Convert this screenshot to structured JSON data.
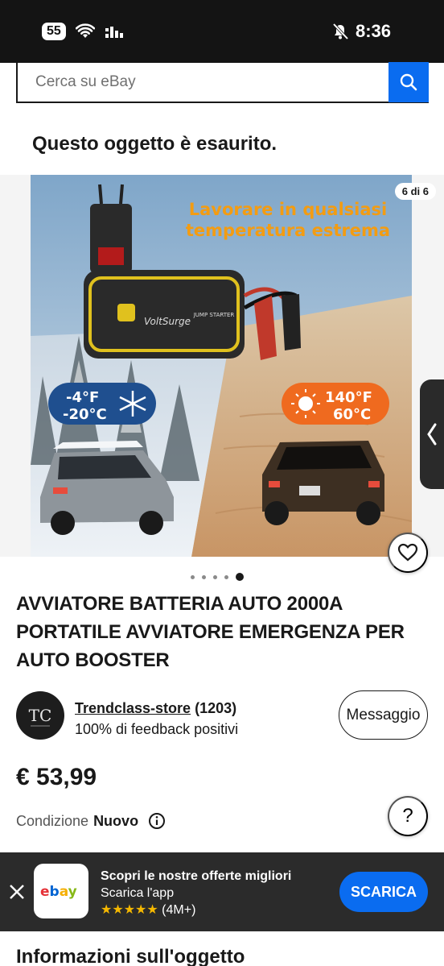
{
  "status_bar": {
    "signal_badge": "55",
    "time": "8:36"
  },
  "search": {
    "placeholder": "Cerca su eBay"
  },
  "out_of_stock": "Questo oggetto è esaurito.",
  "gallery": {
    "counter": "6 di 6",
    "headline_line1": "Lavorare in qualsiasi",
    "headline_line2": "temperatura estrema",
    "cold_f": "-4°F",
    "cold_c": "-20°C",
    "hot_f": "140°F",
    "hot_c": "60°C",
    "brand": "VoltSurge",
    "product_label": "JUMP STARTER",
    "dots_total": 5,
    "active_dot": 5
  },
  "item": {
    "title": "AVVIATORE BATTERIA AUTO 2000A PORTATILE AVVIATORE EMERGENZA PER AUTO BOOSTER"
  },
  "seller": {
    "name": "Trendclass-store",
    "count": "(1203)",
    "feedback": "100% di feedback positivi",
    "message_label": "Messaggio"
  },
  "price": "€ 53,99",
  "condition": {
    "label": "Condizione",
    "value": "Nuovo"
  },
  "help_label": "?",
  "app_banner": {
    "title": "Scopri le nostre offerte migliori",
    "subtitle": "Scarica l'app",
    "stars": "★★★★★",
    "rating_count": "(4M+)",
    "download_label": "SCARICA",
    "logo_text": "ebay"
  },
  "section_heading": "Informazioni sull'oggetto",
  "colors": {
    "ebay_blue": "#0a6cf0",
    "banner_bg": "#2b2b2b",
    "text": "#191919"
  }
}
